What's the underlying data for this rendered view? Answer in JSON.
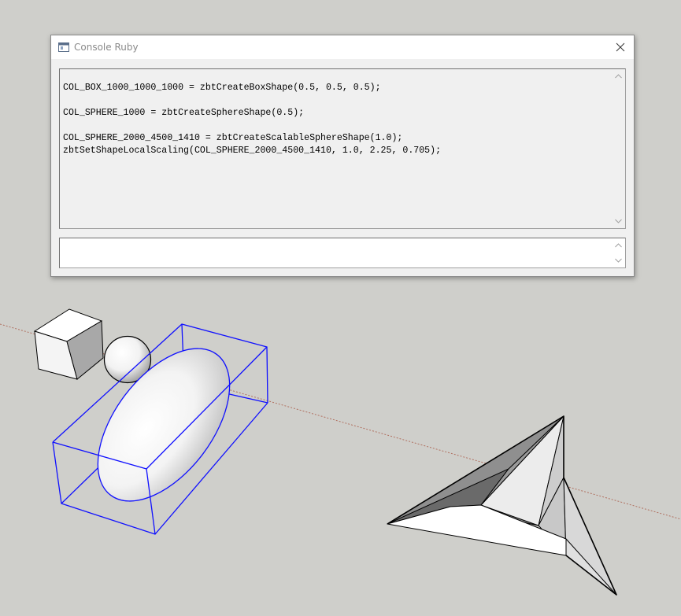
{
  "window": {
    "title": "Console Ruby",
    "icon": "ruby-console-icon",
    "close_icon": "close-icon"
  },
  "console": {
    "output_lines": [
      "COL_BOX_1000_1000_1000 = zbtCreateBoxShape(0.5, 0.5, 0.5);",
      "",
      "COL_SPHERE_1000 = zbtCreateSphereShape(0.5);",
      "",
      "COL_SPHERE_2000_4500_1410 = zbtCreateScalableSphereShape(1.0);",
      "zbtSetShapeLocalScaling(COL_SPHERE_2000_4500_1410, 1.0, 2.25, 0.705);"
    ],
    "input_value": ""
  },
  "colors": {
    "viewport_background": "#cfcfcb",
    "selection_box": "#0000ff",
    "axis_line": "#b07060"
  },
  "scene_objects": [
    "cube",
    "sphere",
    "ellipsoid",
    "bounding-box",
    "polyhedron"
  ]
}
